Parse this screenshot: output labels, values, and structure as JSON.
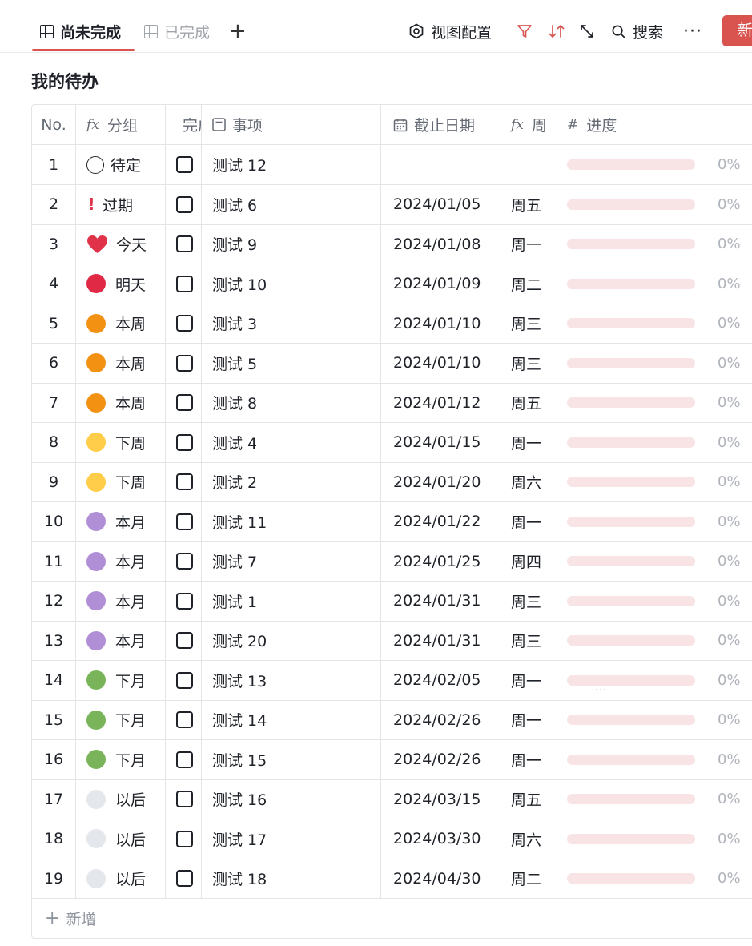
{
  "tabs": [
    {
      "label": "尚未完成",
      "active": true
    },
    {
      "label": "已完成",
      "active": false
    }
  ],
  "toolbar": {
    "view_config_label": "视图配置",
    "search_label": "搜索",
    "more_label": "···",
    "new_label": "新",
    "accent_color": "#d9534f"
  },
  "view_title": "我的待办",
  "columns": {
    "no": "No.",
    "group": "分组",
    "done": "完成",
    "item": "事项",
    "date": "截止日期",
    "weekday": "周",
    "progress": "进度"
  },
  "rows": [
    {
      "no": "1",
      "group": "待定",
      "group_style": "circle-outline",
      "item": "测试 12",
      "date": "",
      "weekday": "",
      "progress": 0,
      "progress_label": "0%"
    },
    {
      "no": "2",
      "group": "过期",
      "group_style": "exclamation",
      "group_color": "#e0334a",
      "item": "测试 6",
      "date": "2024/01/05",
      "weekday": "周五",
      "progress": 0,
      "progress_label": "0%"
    },
    {
      "no": "3",
      "group": "今天",
      "group_style": "heart",
      "group_color": "#e0334a",
      "item": "测试 9",
      "date": "2024/01/08",
      "weekday": "周一",
      "progress": 0,
      "progress_label": "0%"
    },
    {
      "no": "4",
      "group": "明天",
      "group_style": "dot",
      "group_color": "#e02a45",
      "item": "测试 10",
      "date": "2024/01/09",
      "weekday": "周二",
      "progress": 0,
      "progress_label": "0%"
    },
    {
      "no": "5",
      "group": "本周",
      "group_style": "dot",
      "group_color": "#f39212",
      "item": "测试 3",
      "date": "2024/01/10",
      "weekday": "周三",
      "progress": 0,
      "progress_label": "0%"
    },
    {
      "no": "6",
      "group": "本周",
      "group_style": "dot",
      "group_color": "#f39212",
      "item": "测试 5",
      "date": "2024/01/10",
      "weekday": "周三",
      "progress": 0,
      "progress_label": "0%"
    },
    {
      "no": "7",
      "group": "本周",
      "group_style": "dot",
      "group_color": "#f39212",
      "item": "测试 8",
      "date": "2024/01/12",
      "weekday": "周五",
      "progress": 0,
      "progress_label": "0%"
    },
    {
      "no": "8",
      "group": "下周",
      "group_style": "dot",
      "group_color": "#ffcd4a",
      "item": "测试 4",
      "date": "2024/01/15",
      "weekday": "周一",
      "progress": 0,
      "progress_label": "0%"
    },
    {
      "no": "9",
      "group": "下周",
      "group_style": "dot",
      "group_color": "#ffcd4a",
      "item": "测试 2",
      "date": "2024/01/20",
      "weekday": "周六",
      "progress": 0,
      "progress_label": "0%"
    },
    {
      "no": "10",
      "group": "本月",
      "group_style": "dot",
      "group_color": "#b08fd6",
      "item": "测试 11",
      "date": "2024/01/22",
      "weekday": "周一",
      "progress": 0,
      "progress_label": "0%"
    },
    {
      "no": "11",
      "group": "本月",
      "group_style": "dot",
      "group_color": "#b08fd6",
      "item": "测试 7",
      "date": "2024/01/25",
      "weekday": "周四",
      "progress": 0,
      "progress_label": "0%"
    },
    {
      "no": "12",
      "group": "本月",
      "group_style": "dot",
      "group_color": "#b08fd6",
      "item": "测试 1",
      "date": "2024/01/31",
      "weekday": "周三",
      "progress": 0,
      "progress_label": "0%"
    },
    {
      "no": "13",
      "group": "本月",
      "group_style": "dot",
      "group_color": "#b08fd6",
      "item": "测试 20",
      "date": "2024/01/31",
      "weekday": "周三",
      "progress": 0,
      "progress_label": "0%"
    },
    {
      "no": "14",
      "group": "下月",
      "group_style": "dot",
      "group_color": "#79b45a",
      "item": "测试 13",
      "date": "2024/02/05",
      "weekday": "周一",
      "progress": 0,
      "progress_label": "0%"
    },
    {
      "no": "15",
      "group": "下月",
      "group_style": "dot",
      "group_color": "#79b45a",
      "item": "测试 14",
      "date": "2024/02/26",
      "weekday": "周一",
      "progress": 0,
      "progress_label": "0%"
    },
    {
      "no": "16",
      "group": "下月",
      "group_style": "dot",
      "group_color": "#79b45a",
      "item": "测试 15",
      "date": "2024/02/26",
      "weekday": "周一",
      "progress": 0,
      "progress_label": "0%"
    },
    {
      "no": "17",
      "group": "以后",
      "group_style": "dot",
      "group_color": "#e4e7eb",
      "item": "测试 16",
      "date": "2024/03/15",
      "weekday": "周五",
      "progress": 0,
      "progress_label": "0%"
    },
    {
      "no": "18",
      "group": "以后",
      "group_style": "dot",
      "group_color": "#e4e7eb",
      "item": "测试 17",
      "date": "2024/03/30",
      "weekday": "周六",
      "progress": 0,
      "progress_label": "0%"
    },
    {
      "no": "19",
      "group": "以后",
      "group_style": "dot",
      "group_color": "#e4e7eb",
      "item": "测试 18",
      "date": "2024/04/30",
      "weekday": "周二",
      "progress": 0,
      "progress_label": "0%"
    }
  ],
  "add_row_label": "新增",
  "drag_handle": "···"
}
